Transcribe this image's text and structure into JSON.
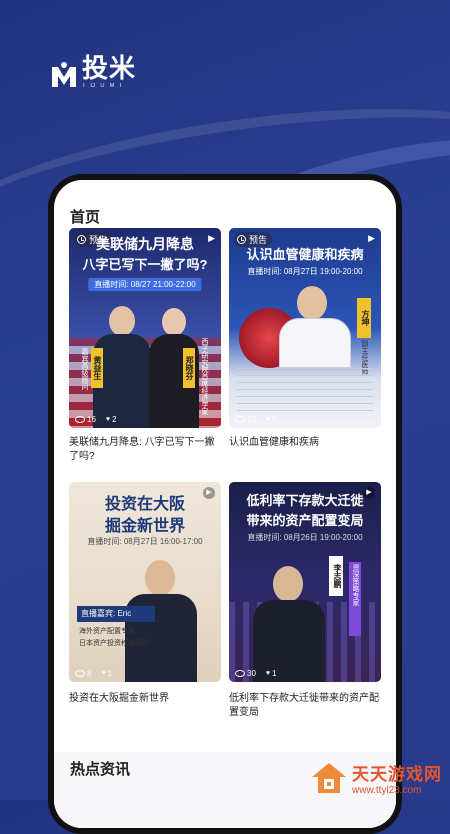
{
  "brand": {
    "name_cn": "投米",
    "name_en": "TOUMI",
    "accent": "#2b3f93"
  },
  "page": {
    "title": "首页"
  },
  "cards": [
    {
      "badge": "预告",
      "headline_lines": [
        "美联储九月降息",
        "八字已写下一撇了吗?"
      ],
      "live_time": "直播时间: 08/27 21:00-22:00",
      "speakers": [
        {
          "name": "黄益生",
          "role": "嘉宾高级顾问"
        },
        {
          "name": "郑晓芬",
          "role": "西子研究院首席经济学家"
        }
      ],
      "views": "16",
      "likes": "2",
      "title": "美联储九月降息: 八字已写下一撇了吗?"
    },
    {
      "badge": "预告",
      "headline_lines": [
        "认识血管健康和疾病"
      ],
      "live_time": "直播时间: 08月27日 19:00-20:00",
      "speakers": [
        {
          "name": "方坤",
          "role": "副主任医师"
        }
      ],
      "views": "10",
      "likes": "0",
      "title": "认识血管健康和疾病"
    },
    {
      "headline_lines": [
        "投资在大阪",
        "掘金新世界"
      ],
      "live_time": "直播时间: 08月27日 16:00-17:00",
      "guest_label": "直播嘉宾: Eric",
      "guest_roles": [
        "海外资产配置专家",
        "日本资产投资权威顾问"
      ],
      "views": "8",
      "likes": "1",
      "title": "投资在大阪掘金新世界"
    },
    {
      "headline_lines": [
        "低利率下存款大迁徙",
        "带来的资产配置变局"
      ],
      "live_time": "直播时间: 08月26日 19:00-20:00",
      "speakers": [
        {
          "name": "李志鹏",
          "role": "资深策略专家"
        }
      ],
      "views": "30",
      "likes": "1",
      "title": "低利率下存款大迁徙带来的资产配置变局"
    }
  ],
  "hot": {
    "title": "热点资讯"
  },
  "watermark": {
    "name": "天天游戏网",
    "url": "www.ttyl23.com"
  }
}
